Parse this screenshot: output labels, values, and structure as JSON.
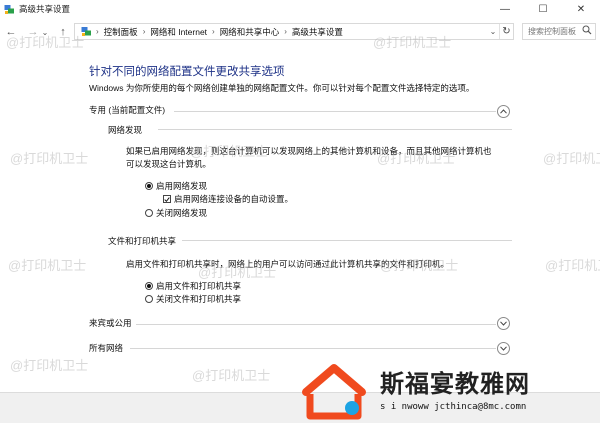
{
  "window": {
    "title": "高级共享设置",
    "minimize": "—",
    "maximize": "☐",
    "close": "✕"
  },
  "nav": {
    "back": "←",
    "forward": "→",
    "recent": "⌄",
    "up": "↑",
    "breadcrumbs": [
      "控制面板",
      "网络和 Internet",
      "网络和共享中心",
      "高级共享设置"
    ],
    "separator": "›",
    "dropdown": "⌄",
    "refresh": "↻",
    "search_placeholder": "搜索控制面板"
  },
  "page": {
    "title": "针对不同的网络配置文件更改共享选项",
    "description": "Windows 为你所使用的每个网络创建单独的网络配置文件。你可以针对每个配置文件选择特定的选项。"
  },
  "private_profile": {
    "label": "专用 (当前配置文件)",
    "network_discovery": {
      "label": "网络发现",
      "description_line1": "如果已启用网络发现，则这台计算机可以发现网络上的其他计算机和设备，而且其他网络计算机也",
      "description_line2": "可以发现这台计算机。",
      "option_on": "启用网络发现",
      "option_auto": "启用网络连接设备的自动设置。",
      "option_off": "关闭网络发现"
    },
    "file_printer": {
      "label": "文件和打印机共享",
      "description": "启用文件和打印机共享时，网络上的用户可以访问通过此计算机共享的文件和打印机。",
      "option_on": "启用文件和打印机共享",
      "option_off": "关闭文件和打印机共享"
    }
  },
  "guest_profile": {
    "label": "来宾或公用"
  },
  "all_networks": {
    "label": "所有网络"
  },
  "watermark": {
    "text": "@打印机卫士",
    "brand": "斯福宴教雅网",
    "url": "s i nwoww jcthinca@8mc.comn"
  },
  "colors": {
    "title_blue": "#1e3287",
    "logo_orange": "#f04a1e",
    "logo_blue": "#1da3e3"
  }
}
